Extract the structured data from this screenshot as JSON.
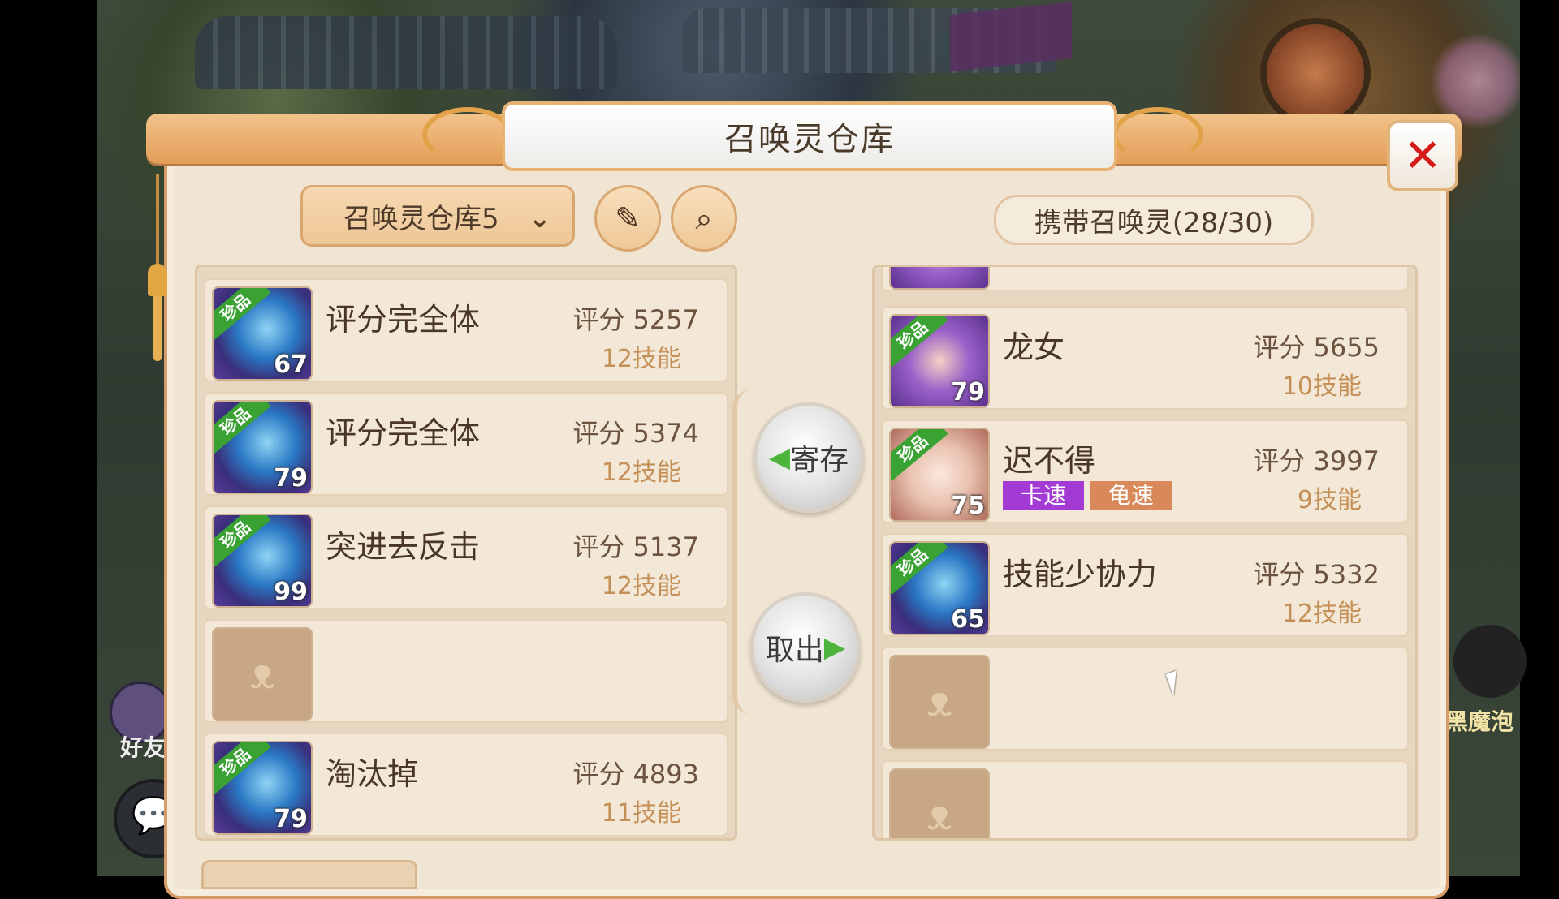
{
  "window": {
    "title": "召唤灵仓库"
  },
  "toolbar": {
    "warehouse_select": "召唤灵仓库5",
    "edit_icon": "edit-icon",
    "search_icon": "search-icon",
    "carry_label": "携带召唤灵(28/30)"
  },
  "close": {
    "icon": "close-icon",
    "glyph": "✕",
    "color": "#d51a1a"
  },
  "actions": {
    "deposit": "寄存",
    "withdraw": "取出"
  },
  "warehouse_list": [
    {
      "badge": "珍品",
      "level": "67",
      "name": "评分完全体",
      "score": "评分 5257",
      "skills": "12技能"
    },
    {
      "badge": "珍品",
      "level": "79",
      "name": "评分完全体",
      "score": "评分 5374",
      "skills": "12技能"
    },
    {
      "badge": "珍品",
      "level": "99",
      "name": "突进去反击",
      "score": "评分 5137",
      "skills": "12技能"
    },
    {
      "empty": true
    },
    {
      "badge": "珍品",
      "level": "79",
      "name": "淘汰掉",
      "score": "评分 4893",
      "skills": "11技能"
    }
  ],
  "carried_list": [
    {
      "badge": "珍品",
      "level": "79",
      "name": "龙女",
      "score": "评分 5655",
      "skills": "10技能"
    },
    {
      "badge": "珍品",
      "level": "75",
      "name": "迟不得",
      "score": "评分 3997",
      "skills": "9技能",
      "tags": [
        "卡速",
        "龟速"
      ]
    },
    {
      "badge": "珍品",
      "level": "65",
      "name": "技能少协力",
      "score": "评分 5332",
      "skills": "12技能"
    },
    {
      "empty": true
    },
    {
      "empty": true
    }
  ],
  "side": {
    "friends_label": "好友",
    "right_label": "黑魔泡"
  },
  "colors": {
    "panel": "#f0e4d2",
    "accent_orange": "#e39e58",
    "badge_green": "#39a232",
    "tag_purple": "#a23ad3",
    "tag_orange": "#d88859"
  }
}
